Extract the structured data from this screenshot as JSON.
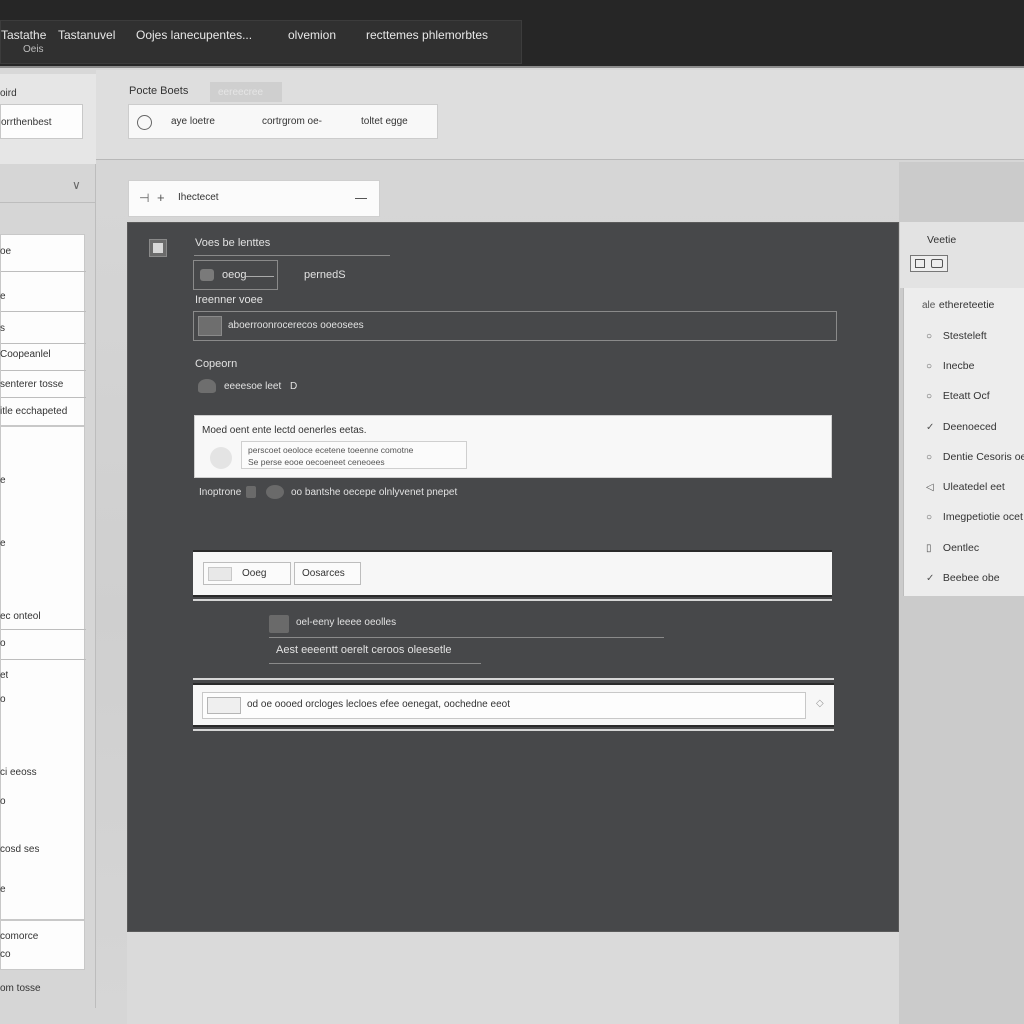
{
  "menubar": {
    "items": [
      "Tastathe",
      "Tastanuvel",
      "Oojes lanecupentes...",
      "olvemion",
      "recttemes phlemorbtes"
    ],
    "subtitle": "Oeis"
  },
  "sidebar": {
    "top_label": "oird",
    "top_button": "orrthenbest",
    "section_chevron": "∨",
    "labels": [
      "oe",
      "e",
      "s",
      "Coopeanlel",
      "senterer tosse",
      "itle ecchapeted",
      "e",
      "e",
      "ec onteol",
      "o",
      "et",
      "o",
      "ci eeoss",
      "o",
      "cosd ses",
      "e",
      "comorce",
      "co",
      "om tosse"
    ]
  },
  "toolbar": {
    "tab_main": "Pocte Boets",
    "tab_secondary": "eereecree",
    "items": [
      "aye loetre",
      "cortrgrom oe-",
      "toltet egge"
    ],
    "breadcrumb_text": "Ihectecet",
    "breadcrumb_plus": "+"
  },
  "content": {
    "checkbox_label": "Voes be lenttes",
    "field1_value": "oeog",
    "field1_suffix": "pernedS",
    "label2": "Ireenner voee",
    "field2_value": "aboerroonrocerecos ooeosees",
    "label3": "Copeorn",
    "field3_value": "eeeesoe leet",
    "field3_suffix": "D",
    "card_title": "Moed oent ente lectd oenerles eetas.",
    "card_line1": "perscoet oeoloce ecetene toeenne comotne",
    "card_line2": "Se perse eooe oecoeneet ceneoees",
    "hint_label": "Inoptrone",
    "hint_text": "oo bantshe oecepe olnlyvenet pnepet",
    "bar1_btn": "Ooeg",
    "bar1_text": "Oosarces",
    "sub_label": "oel-eeny leeee oeolles",
    "sub_text": "Aest eeeentt oerelt ceroos oleesetle",
    "bar2_text": "od oe oooed orcloges lecloes efee oenegat, oochedne eeot"
  },
  "right_panel": {
    "title": "Veetie",
    "items": [
      {
        "icon": "ale",
        "label": "ethereteetie"
      },
      {
        "icon": "○",
        "label": "Stesteleft"
      },
      {
        "icon": "○",
        "label": "Inecbe"
      },
      {
        "icon": "○",
        "label": "Eteatt Ocf"
      },
      {
        "icon": "✓",
        "label": "Deenoeced"
      },
      {
        "icon": "○",
        "label": "Dentie Cesoris oe"
      },
      {
        "icon": "◁",
        "label": "Uleatedel eet"
      },
      {
        "icon": "○",
        "label": "Imegpetiotie ocet"
      },
      {
        "icon": "▯",
        "label": "Oentlec"
      },
      {
        "icon": "✓",
        "label": "Beebee obe"
      }
    ]
  }
}
